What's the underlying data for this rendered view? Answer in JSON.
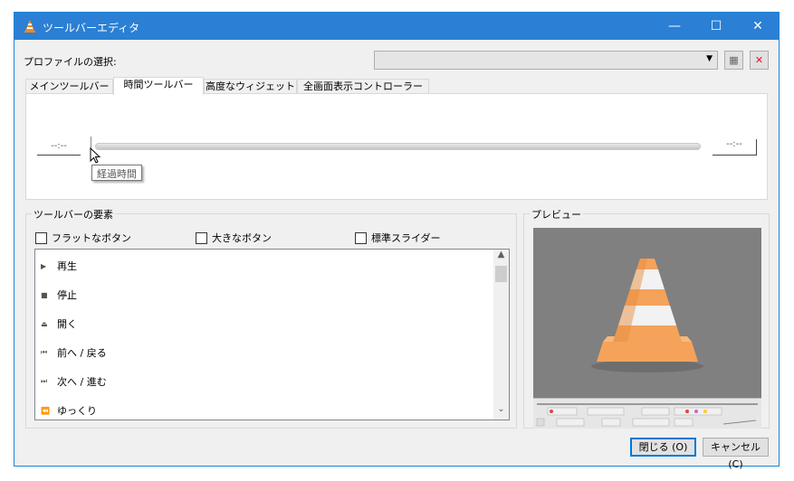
{
  "window": {
    "title": "ツールバーエディタ",
    "minimize_glyph": "—",
    "maximize_glyph": "☐",
    "close_glyph": "✕"
  },
  "profile": {
    "label": "プロファイルの選択:",
    "selected_value": "",
    "arrow_glyph": "▼",
    "new_glyph": "▦",
    "delete_glyph": "✕"
  },
  "tabs": [
    {
      "label": "メインツールバー"
    },
    {
      "label": "時間ツールバー"
    },
    {
      "label": "高度なウィジェット"
    },
    {
      "label": "全画面表示コントローラー"
    }
  ],
  "time_toolbar": {
    "elapsed_time": "--:--",
    "remaining_time": "--:--",
    "tooltip": "経過時間"
  },
  "elements": {
    "title": "ツールバーの要素",
    "options": [
      {
        "label": "フラットなボタン"
      },
      {
        "label": "大きなボタン"
      },
      {
        "label": "標準スライダー"
      }
    ],
    "items": [
      {
        "icon": "▶",
        "label": "再生"
      },
      {
        "icon": "■",
        "label": "停止"
      },
      {
        "icon": "⏏",
        "label": "開く"
      },
      {
        "icon": "⏮",
        "label": "前へ / 戻る"
      },
      {
        "icon": "⏭",
        "label": "次へ / 進む"
      },
      {
        "icon": "⏪",
        "label": "ゆっくり"
      }
    ],
    "scroll_up_glyph": "▲",
    "scroll_down_glyph": "⌄"
  },
  "preview": {
    "title": "プレビュー"
  },
  "buttons": {
    "close": "閉じる (O)",
    "cancel": "キャンセル (C)"
  },
  "colors": {
    "titlebar": "#2b7fd4",
    "delete_red": "#e81123",
    "cone_orange": "#f5a25a"
  }
}
